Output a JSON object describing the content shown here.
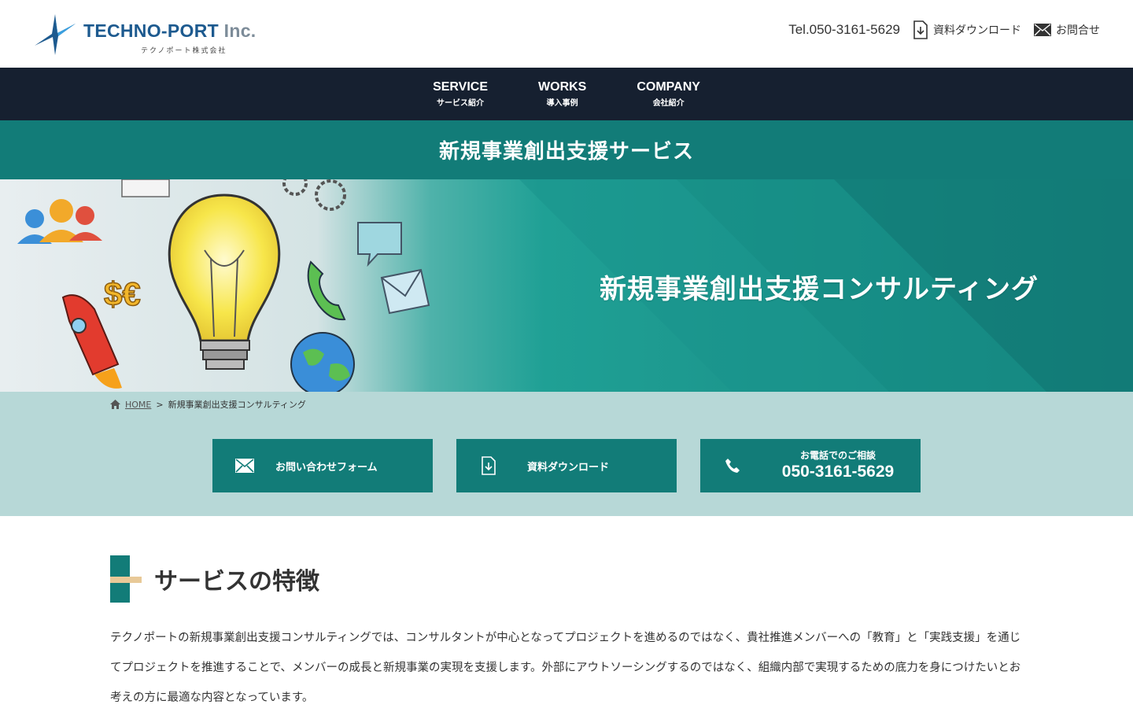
{
  "header": {
    "logo_name": "TECHNO-PORT",
    "logo_inc": " Inc.",
    "logo_sub": "テクノポート株式会社",
    "tel": "Tel.050-3161-5629",
    "download_label": "資料ダウンロード",
    "contact_label": "お問合せ"
  },
  "nav": {
    "items": [
      {
        "en": "SERVICE",
        "ja": "サービス紹介"
      },
      {
        "en": "WORKS",
        "ja": "導入事例"
      },
      {
        "en": "COMPANY",
        "ja": "会社紹介"
      }
    ]
  },
  "titlebar": {
    "title": "新規事業創出支援サービス"
  },
  "hero": {
    "title": "新規事業創出支援コンサルティング",
    "money_text": "$€"
  },
  "breadcrumb": {
    "home": "HOME",
    "separator": ">",
    "current": "新規事業創出支援コンサルティング"
  },
  "actions": {
    "form_label": "お問い合わせフォーム",
    "download_label": "資料ダウンロード",
    "tel_small": "お電話でのご相談",
    "tel_number": "050-3161-5629"
  },
  "section": {
    "heading": "サービスの特徴",
    "paragraph": "テクノポートの新規事業創出支援コンサルティングでは、コンサルタントが中心となってプロジェクトを進めるのではなく、貴社推進メンバーへの「教育」と「実践支援」を通じてプロジェクトを推進することで、メンバーの成長と新規事業の実現を支援します。外部にアウトソーシングするのではなく、組織内部で実現するための底力を身につけたいとお考えの方に最適な内容となっています。"
  },
  "colors": {
    "teal": "#127c78",
    "navy": "#162030",
    "band": "#b7d8d7",
    "accent": "#e8c998"
  }
}
